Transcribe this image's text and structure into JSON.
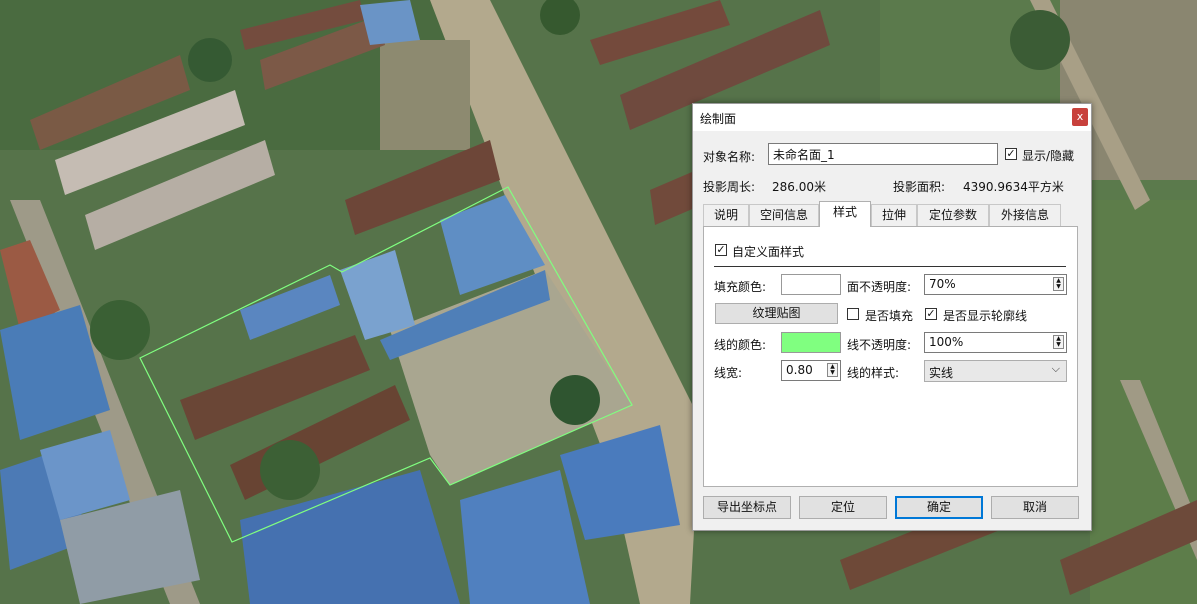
{
  "dialog": {
    "title": "绘制面",
    "close_glyph": "x",
    "name_label": "对象名称:",
    "name_value": "未命名面_1",
    "show_hide_label": "显示/隐藏",
    "show_hide_checked": true,
    "perimeter_label": "投影周长:",
    "perimeter_value": "286.00米",
    "area_label": "投影面积:",
    "area_value": "4390.9634平方米",
    "tabs": [
      {
        "label": "说明",
        "active": false
      },
      {
        "label": "空间信息",
        "active": false
      },
      {
        "label": "样式",
        "active": true
      },
      {
        "label": "拉伸",
        "active": false
      },
      {
        "label": "定位参数",
        "active": false
      },
      {
        "label": "外接信息",
        "active": false
      }
    ],
    "style": {
      "custom_style_label": "自定义面样式",
      "custom_style_checked": true,
      "fill_color_label": "填充颜色:",
      "fill_color": "#ffffff",
      "fill_opacity_label": "面不透明度:",
      "fill_opacity_value": "70%",
      "texture_button": "纹理贴图",
      "is_fill_label": "是否填充",
      "is_fill_checked": false,
      "show_outline_label": "是否显示轮廓线",
      "show_outline_checked": true,
      "line_color_label": "线的颜色:",
      "line_color": "#80ff80",
      "line_opacity_label": "线不透明度:",
      "line_opacity_value": "100%",
      "line_width_label": "线宽:",
      "line_width_value": "0.80",
      "line_style_label": "线的样式:",
      "line_style_value": "实线"
    },
    "buttons": {
      "export": "导出坐标点",
      "locate": "定位",
      "ok": "确定",
      "cancel": "取消"
    }
  },
  "map": {
    "polygon_color": "#80ff80"
  }
}
